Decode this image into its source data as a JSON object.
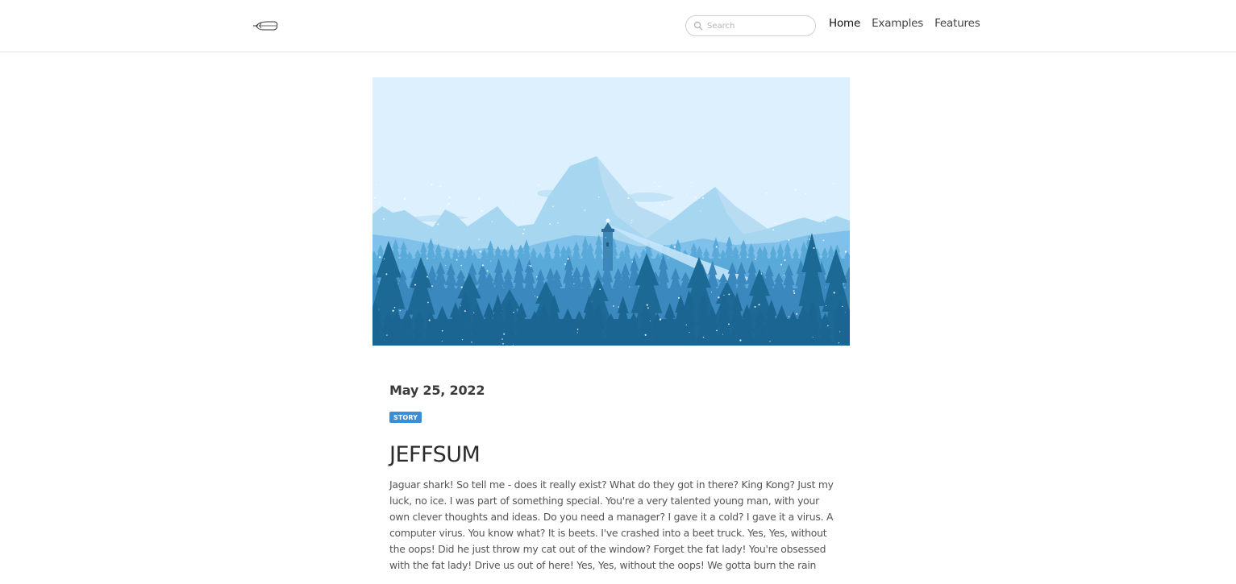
{
  "navbar": {
    "logo_icon": "feather-quill-icon",
    "search": {
      "placeholder": "Search",
      "value": "",
      "icon": "search-icon"
    },
    "links": [
      {
        "label": "Home",
        "active": true
      },
      {
        "label": "Examples",
        "active": false
      },
      {
        "label": "Features",
        "active": false
      }
    ]
  },
  "hero_image": {
    "description": "Illustration of snowy blue mountains with a lighthouse casting a beam over a pine forest",
    "colors": {
      "sky": "#dcf1fd",
      "far_mountain": "#a7d6f1",
      "mid": "#7fc1ea",
      "forest_mid": "#4c9ccd",
      "forest_front": "#1b6592"
    }
  },
  "article": {
    "date": "May 25, 2022",
    "tag": "STORY",
    "tag_color": "#3b8dd4",
    "title": "JEFFSUM",
    "body": "Jaguar shark! So tell me - does it really exist? What do they got in there? King Kong? Just my luck, no ice. I was part of something special. You're a very talented young man, with your own clever thoughts and ideas. Do you need a manager? I gave it a cold? I gave it a virus. A computer virus. You know what? It is beets. I've crashed into a beet truck. Yes, Yes, without the oops! Did he just throw my cat out of the window? Forget the fat lady! You're obsessed with the fat lady! Drive us out of here! Yes, Yes, without the oops! We gotta burn the rain"
  }
}
